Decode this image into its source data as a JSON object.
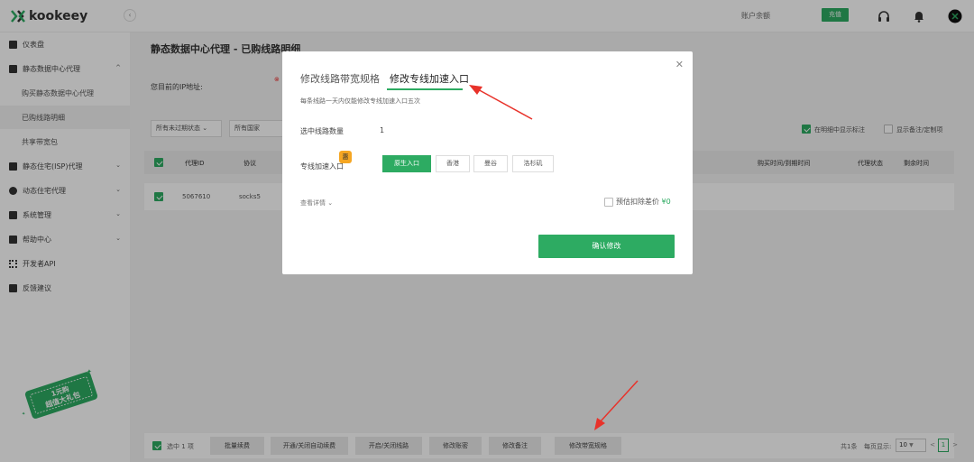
{
  "app": {
    "logo_text": "kookeey",
    "balance_label": "账户余额",
    "recharge_label": "充值"
  },
  "colors": {
    "accent": "#2dab62",
    "annotation": "#e8322a",
    "badge": "#f5a623"
  },
  "icons": {
    "support": "headset-icon",
    "notifications": "bell-icon",
    "avatar": "avatar-icon"
  },
  "sidebar": {
    "items": [
      {
        "label": "仪表盘",
        "icon": "dashboard-icon"
      },
      {
        "label": "静态数据中心代理",
        "icon": "server-icon"
      },
      {
        "label": "购买静态数据中心代理"
      },
      {
        "label": "已购线路明细"
      },
      {
        "label": "共享带宽包"
      },
      {
        "label": "静态住宅(ISP)代理",
        "icon": "home-icon"
      },
      {
        "label": "动态住宅代理",
        "icon": "globe-icon"
      },
      {
        "label": "系统管理",
        "icon": "edit-icon"
      },
      {
        "label": "帮助中心",
        "icon": "hand-icon"
      },
      {
        "label": "开发者API",
        "icon": "api-icon"
      },
      {
        "label": "反馈建议",
        "icon": "feedback-icon"
      }
    ],
    "gift_line1": "1元购",
    "gift_line2": "超值大礼包"
  },
  "main": {
    "title": "静态数据中心代理 - 已购线路明细",
    "ip_label": "您目前的IP地址:",
    "filters": {
      "expiry": "所有未过期状态",
      "country": "所有国家"
    },
    "options": {
      "show_in_detail": "在明细中显示标注",
      "show_remark": "显示备注/定制项"
    },
    "table": {
      "headers": {
        "proxy_id": "代理ID",
        "protocol": "协议",
        "purchase_expiry": "购买时间/到期时间",
        "status": "代理状态",
        "remaining": "剩余时间"
      },
      "rows": [
        {
          "proxy_id": "5067610",
          "protocol": "socks5"
        }
      ]
    },
    "footer": {
      "selected": "选中 1 项",
      "buttons": [
        "批量续费",
        "开通/关闭自动续费",
        "开启/关闭线路",
        "修改账密",
        "修改备注",
        "修改带宽规格"
      ],
      "total": "共1条",
      "per_page_label": "每页显示:",
      "per_page": "10",
      "page": "1"
    }
  },
  "modal": {
    "tabs": [
      "修改线路带宽规格",
      "修改专线加速入口"
    ],
    "note": "每条线路一天内仅能修改专线加速入口五次",
    "count_label": "选中线路数量",
    "count_value": "1",
    "entry_label": "专线加速入口",
    "hint_badge": "惠",
    "entries": [
      "原生入口",
      "香港",
      "曼谷",
      "洛杉矶"
    ],
    "details_label": "查看详情 ⌄",
    "estimate_label": "预估扣除差价",
    "estimate_value": "¥0",
    "confirm_label": "确认修改"
  }
}
